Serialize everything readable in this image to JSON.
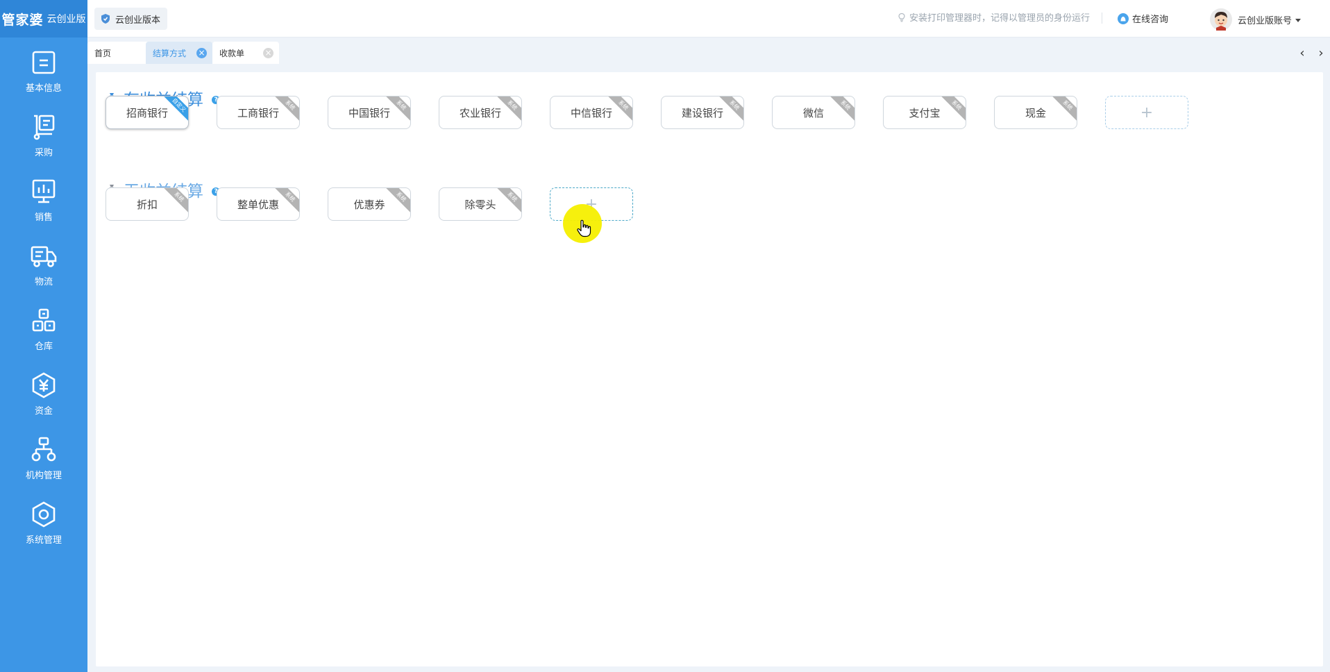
{
  "brand": {
    "name": "管家婆",
    "edition": "云创业版"
  },
  "sidebar": {
    "items": [
      {
        "label": "基本信息",
        "icon": "document-icon"
      },
      {
        "label": "采购",
        "icon": "clipboard-cart-icon"
      },
      {
        "label": "销售",
        "icon": "chart-monitor-icon"
      },
      {
        "label": "物流",
        "icon": "truck-icon"
      },
      {
        "label": "仓库",
        "icon": "warehouse-boxes-icon"
      },
      {
        "label": "资金",
        "icon": "yuan-icon"
      },
      {
        "label": "机构管理",
        "icon": "org-chart-icon"
      },
      {
        "label": "系统管理",
        "icon": "settings-hex-icon"
      }
    ]
  },
  "header": {
    "edition_label": "云创业版本",
    "tip": "安装打印管理器时，记得以管理员的身份运行",
    "consult": "在线咨询",
    "account": "云创业版账号"
  },
  "tabs": [
    {
      "label": "首页",
      "closable": false
    },
    {
      "label": "结算方式",
      "closable": true,
      "active": true
    },
    {
      "label": "收款单",
      "closable": true
    }
  ],
  "sections": {
    "profit": {
      "title": "有收益结算",
      "items": [
        {
          "label": "招商银行",
          "tag": "自定义"
        },
        {
          "label": "工商银行",
          "tag": "系统"
        },
        {
          "label": "中国银行",
          "tag": "系统"
        },
        {
          "label": "农业银行",
          "tag": "系统"
        },
        {
          "label": "中信银行",
          "tag": "系统"
        },
        {
          "label": "建设银行",
          "tag": "系统"
        },
        {
          "label": "微信",
          "tag": "系统"
        },
        {
          "label": "支付宝",
          "tag": "系统"
        },
        {
          "label": "现金",
          "tag": "系统"
        }
      ],
      "add": "+"
    },
    "noprofit": {
      "title": "无收益结算",
      "items": [
        {
          "label": "折扣",
          "tag": "系统"
        },
        {
          "label": "整单优惠",
          "tag": "系统"
        },
        {
          "label": "优惠券",
          "tag": "系统"
        },
        {
          "label": "除零头",
          "tag": "系统"
        }
      ],
      "add": "+"
    }
  },
  "help": "?",
  "colors": {
    "sidebar": "#3d96e6",
    "accent": "#3d8fdc",
    "highlight": "#f5ef00"
  }
}
